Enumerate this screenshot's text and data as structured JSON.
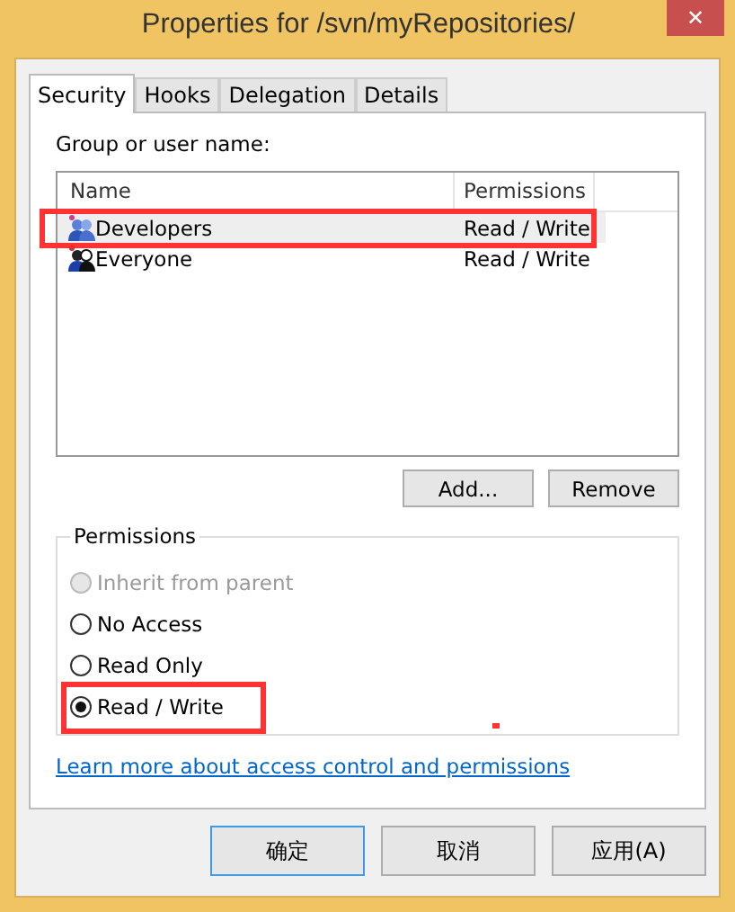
{
  "window": {
    "title": "Properties for /svn/myRepositories/",
    "close": "✕"
  },
  "tabs": [
    {
      "label": "Security",
      "selected": true
    },
    {
      "label": "Hooks",
      "selected": false
    },
    {
      "label": "Delegation",
      "selected": false
    },
    {
      "label": "Details",
      "selected": false
    }
  ],
  "group_label": "Group or user name:",
  "table": {
    "columns": [
      "Name",
      "Permissions"
    ],
    "rows": [
      {
        "name": "Developers",
        "permissions": "Read / Write",
        "kind": "group",
        "selected": true,
        "annotated": true
      },
      {
        "name": "Everyone",
        "permissions": "Read / Write",
        "kind": "everyone",
        "selected": false,
        "annotated": false
      }
    ]
  },
  "list_buttons": [
    "Add...",
    "Remove"
  ],
  "permissions": {
    "legend": "Permissions",
    "options": [
      {
        "label": "Inherit from parent",
        "selected": false,
        "disabled": true,
        "annotated": false
      },
      {
        "label": "No Access",
        "selected": false,
        "disabled": false,
        "annotated": false
      },
      {
        "label": "Read Only",
        "selected": false,
        "disabled": false,
        "annotated": false
      },
      {
        "label": "Read / Write",
        "selected": true,
        "disabled": false,
        "annotated": true
      }
    ]
  },
  "link": "Learn more about access control and permissions",
  "buttons": [
    {
      "label": "确定",
      "default": true
    },
    {
      "label": "取消",
      "default": false
    },
    {
      "label": "应用(A)",
      "default": false
    }
  ]
}
